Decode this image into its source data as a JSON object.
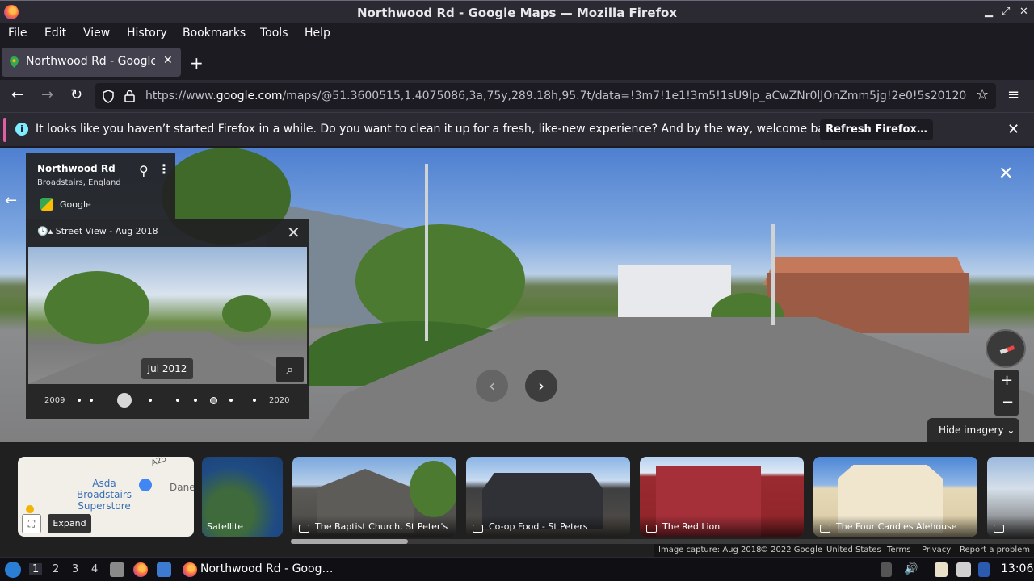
{
  "window": {
    "title": "Northwood Rd - Google Maps — Mozilla Firefox",
    "minimize": "▁",
    "maximize": "⤢",
    "close": "✕"
  },
  "menu": [
    "File",
    "Edit",
    "View",
    "History",
    "Bookmarks",
    "Tools",
    "Help"
  ],
  "tab": {
    "label": "Northwood Rd - Google M",
    "close": "✕",
    "new_tab": "+"
  },
  "nav": {
    "back": "←",
    "forward": "→",
    "reload": "↻",
    "url_prefix": "https://www.",
    "url_host": "google.com",
    "url_rest": "/maps/@51.3600515,1.4075086,3a,75y,289.18h,95.7t/data=!3m7!1e1!3m5!1sU9lp_aCwZNr0lJOnZmm5jg!2e0!5s20120",
    "star": "☆",
    "menu": "≡"
  },
  "notification": {
    "message": "It looks like you haven’t started Firefox in a while. Do you want to clean it up for a fresh, like-new experience? And by the way, welcome back!",
    "button": "Refresh Firefox…",
    "close": "✕",
    "info_glyph": "i",
    "accent_color": "#e05ea3"
  },
  "place": {
    "name": "Northwood Rd",
    "region": "Broadstairs, England",
    "provider": "Google"
  },
  "timeline": {
    "header": "Street View - Aug 2018",
    "tooltip": "Jul 2012",
    "start_year": "2009",
    "end_year": "2020"
  },
  "controls": {
    "hide_imagery": "Hide imagery",
    "zoom_in": "+",
    "zoom_out": "−",
    "close_sv": "✕",
    "prev": "‹",
    "next": "›",
    "back": "←"
  },
  "map_card": {
    "poi": "Asda Broadstairs Superstore",
    "town": "Dane",
    "road": "A25",
    "expand": "Expand"
  },
  "photo_cards": [
    {
      "label": "Satellite"
    },
    {
      "label": "The Baptist Church, St Peter's"
    },
    {
      "label": "Co-op Food - St Peters"
    },
    {
      "label": "The Red Lion"
    },
    {
      "label": "The Four Candles Alehouse"
    }
  ],
  "attribution": [
    "Image capture: Aug 2018",
    "© 2022 Google",
    "United States",
    "Terms",
    "Privacy",
    "Report a problem"
  ],
  "taskbar": {
    "workspaces": [
      "1",
      "2",
      "3",
      "4"
    ],
    "active_window": "Northwood Rd - Goog…",
    "clock": "13:06"
  }
}
